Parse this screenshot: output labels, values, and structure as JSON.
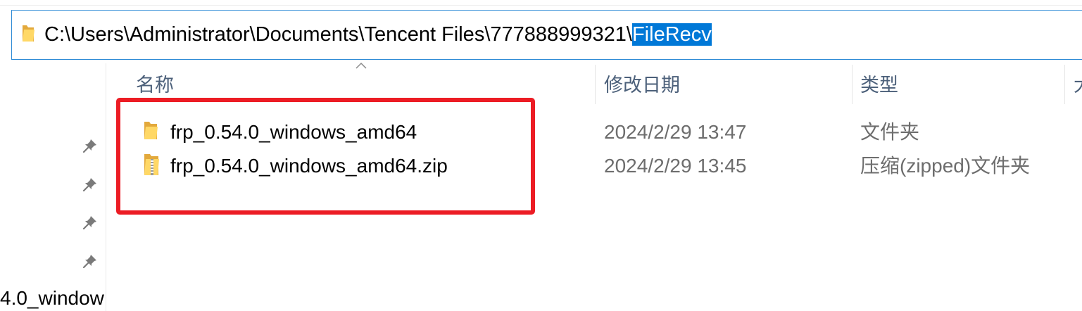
{
  "address_bar": {
    "icon": "folder-icon",
    "path_prefix": "C:\\Users\\Administrator\\Documents\\Tencent Files\\777888999321\\",
    "path_selected": "FileRecv"
  },
  "nav_pane": {
    "pins": [
      "pin-icon",
      "pin-icon",
      "pin-icon",
      "pin-icon"
    ],
    "clipped_item_label": "4.0_window"
  },
  "columns": {
    "name": "名称",
    "modified": "修改日期",
    "type": "类型",
    "size_clipped": "大",
    "sort_indicator_icon": "chevron-up-icon"
  },
  "files": [
    {
      "icon": "folder-icon",
      "name": "frp_0.54.0_windows_amd64",
      "modified": "2024/2/29 13:47",
      "type": "文件夹"
    },
    {
      "icon": "zip-folder-icon",
      "name": "frp_0.54.0_windows_amd64.zip",
      "modified": "2024/2/29 13:45",
      "type": "压缩(zipped)文件夹"
    }
  ],
  "colors": {
    "selection_background": "#0078d7",
    "selection_text": "#ffffff",
    "address_border": "#2e8bd6",
    "header_text": "#4c607a",
    "secondary_text": "#6d6d6d",
    "annotation": "#ec1c24",
    "folder_yellow": "#ffd866"
  }
}
